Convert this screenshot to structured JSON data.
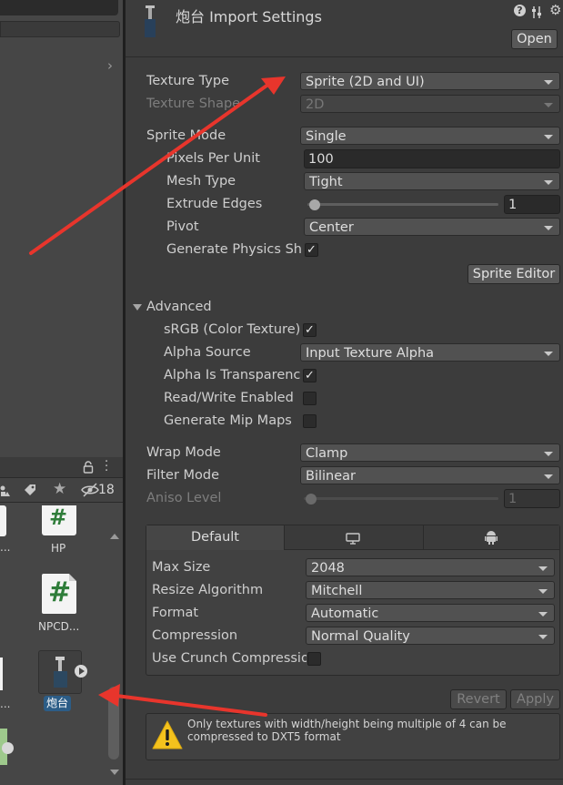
{
  "window": {
    "title": "炮台 Import Settings",
    "open_button": "Open"
  },
  "texture_type": {
    "label": "Texture Type",
    "value": "Sprite (2D and UI)"
  },
  "texture_shape": {
    "label": "Texture Shape",
    "value": "2D"
  },
  "sprite_mode": {
    "label": "Sprite Mode",
    "value": "Single"
  },
  "pixels_per_unit": {
    "label": "Pixels Per Unit",
    "value": "100"
  },
  "mesh_type": {
    "label": "Mesh Type",
    "value": "Tight"
  },
  "extrude_edges": {
    "label": "Extrude Edges",
    "value": "1",
    "level": 1,
    "max": 32
  },
  "pivot": {
    "label": "Pivot",
    "value": "Center"
  },
  "generate_physics_shape": {
    "label": "Generate Physics Shape",
    "checked": true
  },
  "sprite_editor_button": "Sprite Editor",
  "advanced": {
    "label": "Advanced",
    "srgb": {
      "label": "sRGB (Color Texture)",
      "checked": true
    },
    "alpha_source": {
      "label": "Alpha Source",
      "value": "Input Texture Alpha"
    },
    "alpha_is_transparency": {
      "label": "Alpha Is Transparency",
      "checked": true
    },
    "read_write": {
      "label": "Read/Write Enabled",
      "checked": false
    },
    "generate_mip_maps": {
      "label": "Generate Mip Maps",
      "checked": false
    }
  },
  "wrap_mode": {
    "label": "Wrap Mode",
    "value": "Clamp"
  },
  "filter_mode": {
    "label": "Filter Mode",
    "value": "Bilinear"
  },
  "aniso_level": {
    "label": "Aniso Level",
    "value": "1",
    "level": 1,
    "max": 16
  },
  "platform": {
    "tabs": [
      "Default"
    ],
    "max_size": {
      "label": "Max Size",
      "value": "2048"
    },
    "resize_algorithm": {
      "label": "Resize Algorithm",
      "value": "Mitchell"
    },
    "format": {
      "label": "Format",
      "value": "Automatic"
    },
    "compression": {
      "label": "Compression",
      "value": "Normal Quality"
    },
    "use_crunch": {
      "label": "Use Crunch Compression",
      "checked": false
    }
  },
  "revert_button": "Revert",
  "apply_button": "Apply",
  "warning": {
    "text": "Only textures with width/height being multiple of 4 can be compressed to DXT5 format"
  },
  "project_panel": {
    "hidden_count": "18",
    "assets": [
      {
        "name": "HP"
      },
      {
        "name": "NPCD..."
      },
      {
        "name": "炮台"
      }
    ],
    "left_truncated": "..."
  },
  "colors": {
    "annotation_arrow": "#e8352c",
    "selected_label": "#2c5d87",
    "script_icon": "#2f7d3a"
  }
}
